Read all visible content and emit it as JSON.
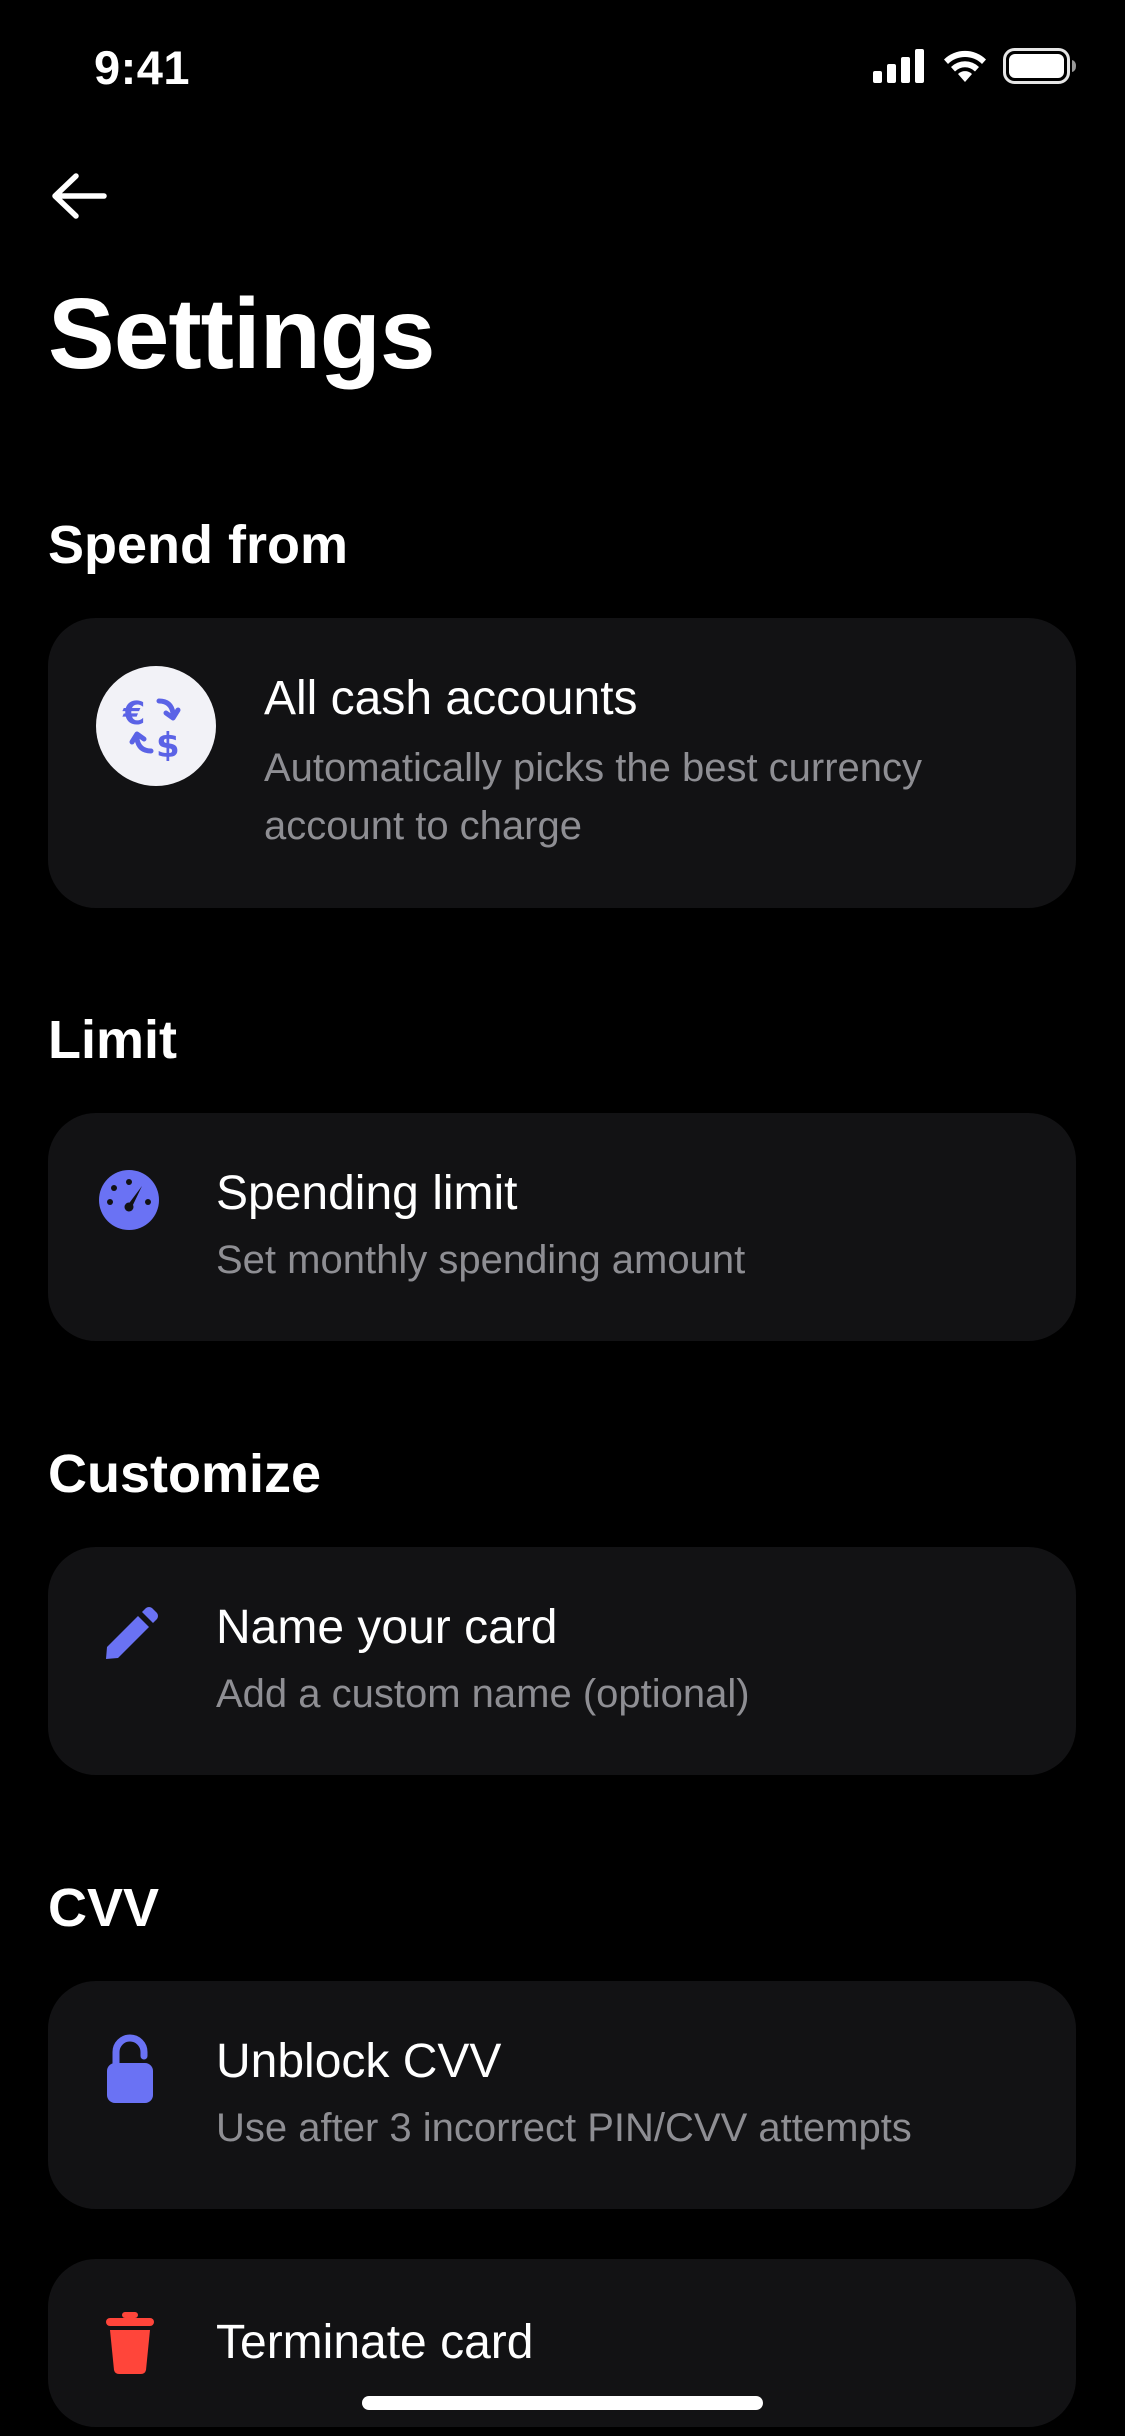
{
  "status_bar": {
    "time": "9:41"
  },
  "header": {
    "title": "Settings"
  },
  "sections": [
    {
      "title": "Spend from",
      "item": {
        "title": "All cash accounts",
        "subtitle": "Automatically picks the best currency account to charge",
        "icon": "currency-exchange-icon"
      }
    },
    {
      "title": "Limit",
      "item": {
        "title": "Spending limit",
        "subtitle": "Set monthly spending amount",
        "icon": "speedometer-icon"
      }
    },
    {
      "title": "Customize",
      "item": {
        "title": "Name your card",
        "subtitle": "Add a custom name (optional)",
        "icon": "pencil-icon"
      }
    },
    {
      "title": "CVV",
      "item": {
        "title": "Unblock CVV",
        "subtitle": "Use after 3 incorrect PIN/CVV attempts",
        "icon": "unlock-icon"
      }
    }
  ],
  "danger_item": {
    "title": "Terminate card",
    "icon": "trash-icon"
  },
  "colors": {
    "background": "#000000",
    "card": "#121214",
    "accent": "#6a72f4",
    "danger": "#ff453a",
    "subtitle": "#8e8e93"
  }
}
